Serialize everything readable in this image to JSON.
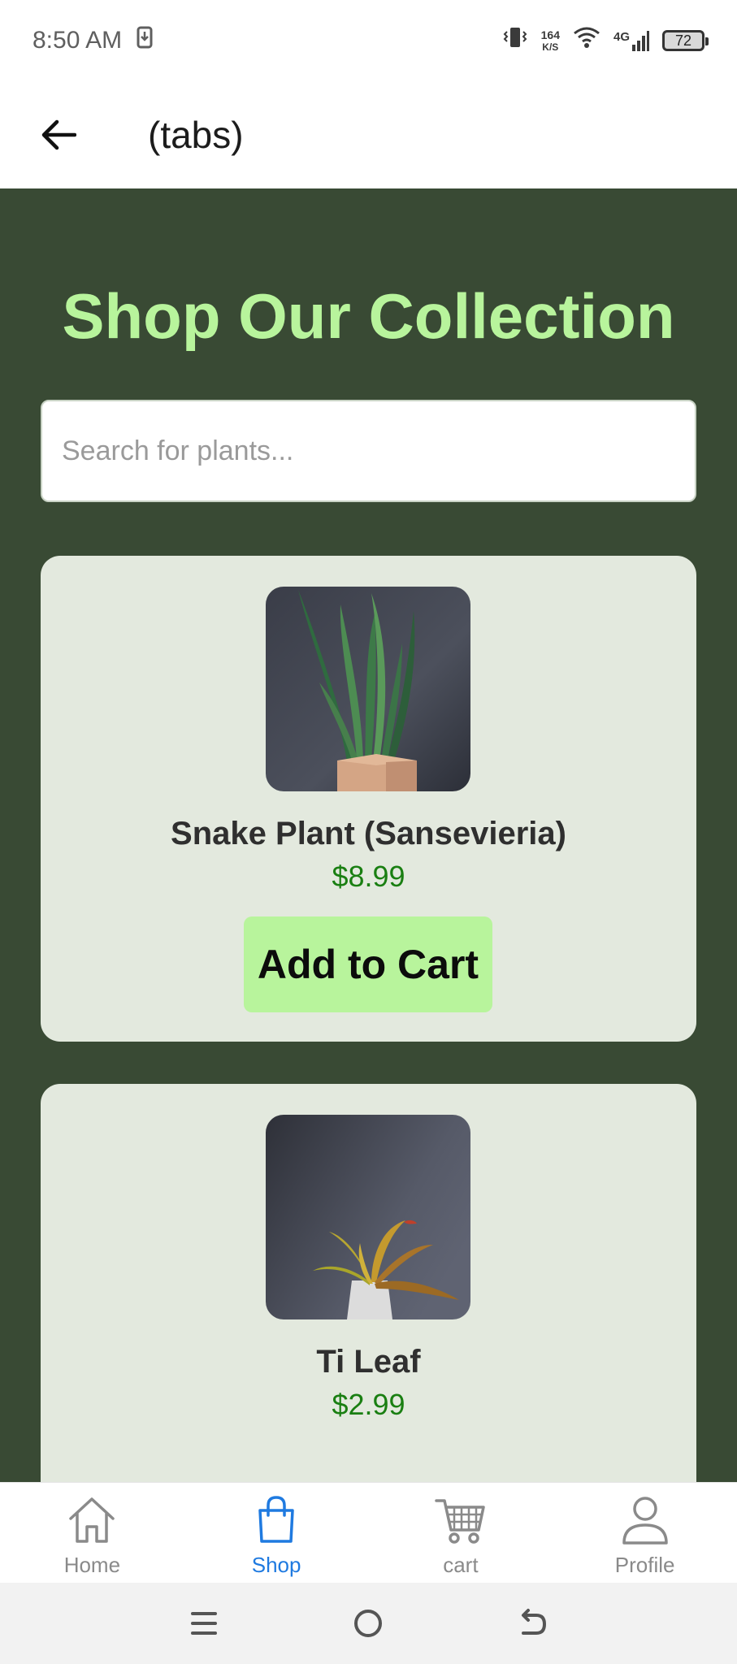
{
  "status_bar": {
    "time": "8:50 AM",
    "net_speed_value": "164",
    "net_speed_unit": "K/S",
    "network_type": "4G",
    "battery": "72"
  },
  "header": {
    "title": "(tabs)",
    "back_icon": "arrow-left-icon"
  },
  "main": {
    "title": "Shop Our Collection",
    "search_placeholder": "Search for plants...",
    "products": [
      {
        "name": "Snake Plant (Sansevieria)",
        "price": "$8.99",
        "button_label": "Add to Cart"
      },
      {
        "name": "Ti Leaf",
        "price": "$2.99"
      }
    ]
  },
  "tabs": [
    {
      "label": "Home",
      "icon": "home-icon",
      "active": false
    },
    {
      "label": "Shop",
      "icon": "shopping-bag-icon",
      "active": true
    },
    {
      "label": "cart",
      "icon": "cart-icon",
      "active": false
    },
    {
      "label": "Profile",
      "icon": "user-icon",
      "active": false
    }
  ],
  "colors": {
    "background": "#394a34",
    "accent": "#b8f49c",
    "card": "#e3e9de",
    "price": "#1a7f12",
    "active_tab": "#1f7ae0"
  }
}
